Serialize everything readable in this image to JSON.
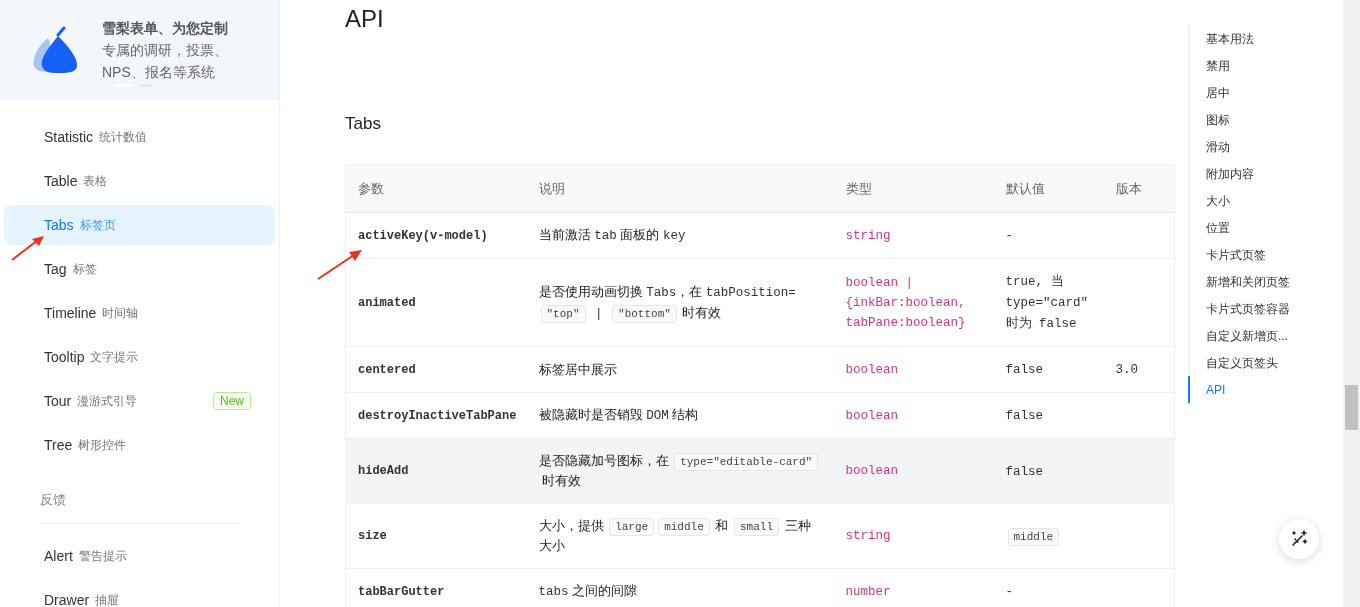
{
  "banner": {
    "title": "雪梨表单、为您定制",
    "text": "专属的调研，投票、NPS、报名等系统",
    "slides": [
      {
        "selected": true
      },
      {
        "selected": false
      }
    ]
  },
  "sidebar": {
    "items": [
      {
        "kind": "item",
        "name": "Statistic",
        "label": "统计数值",
        "selected": false
      },
      {
        "kind": "item",
        "name": "Table",
        "label": "表格",
        "selected": false
      },
      {
        "kind": "item",
        "name": "Tabs",
        "label": "标签页",
        "selected": true
      },
      {
        "kind": "item",
        "name": "Tag",
        "label": "标签",
        "selected": false
      },
      {
        "kind": "item",
        "name": "Timeline",
        "label": "时间轴",
        "selected": false
      },
      {
        "kind": "item",
        "name": "Tooltip",
        "label": "文字提示",
        "selected": false
      },
      {
        "kind": "item",
        "name": "Tour",
        "label": "漫游式引导",
        "selected": false,
        "badge": "New"
      },
      {
        "kind": "item",
        "name": "Tree",
        "label": "树形控件",
        "selected": false
      },
      {
        "kind": "group",
        "label": "反馈"
      },
      {
        "kind": "item",
        "name": "Alert",
        "label": "警告提示",
        "selected": false
      },
      {
        "kind": "item",
        "name": "Drawer",
        "label": "抽屉",
        "selected": false
      }
    ]
  },
  "main": {
    "title": "API",
    "section": "Tabs",
    "table": {
      "columns": [
        "参数",
        "说明",
        "类型",
        "默认值",
        "版本"
      ],
      "rows": [
        {
          "name": "activeKey(v-model)",
          "description": [
            {
              "kind": "text",
              "text": "当前激活 "
            },
            {
              "kind": "mono",
              "text": "tab"
            },
            {
              "kind": "text",
              "text": " 面板的 "
            },
            {
              "kind": "mono",
              "text": "key"
            }
          ],
          "type": "string",
          "default": [
            {
              "kind": "mono",
              "text": "-"
            }
          ],
          "highlighted": false
        },
        {
          "name": "animated",
          "description": [
            {
              "kind": "text",
              "text": "是否使用动画切换 "
            },
            {
              "kind": "mono",
              "text": "Tabs"
            },
            {
              "kind": "text",
              "text": "，在 "
            },
            {
              "kind": "mono",
              "text": "tabPosition="
            },
            {
              "kind": "code",
              "text": "″top″"
            },
            {
              "kind": "mono",
              "text": " | "
            },
            {
              "kind": "code",
              "text": "″bottom″"
            },
            {
              "kind": "text",
              "text": " 时有效"
            }
          ],
          "type": "boolean | {inkBar:boolean, tabPane:boolean}",
          "default": [
            {
              "kind": "mono",
              "text": "true, 当 "
            },
            {
              "kind": "mono",
              "text": "type=\"card\""
            },
            {
              "kind": "mono",
              "text": "时为 false"
            }
          ],
          "highlighted": false
        },
        {
          "name": "centered",
          "description": [
            {
              "kind": "text",
              "text": "标签居中展示"
            }
          ],
          "type": "boolean",
          "default": [
            {
              "kind": "mono",
              "text": "false"
            }
          ],
          "version": "3.0",
          "highlighted": false
        },
        {
          "name": "destroyInactiveTabPane",
          "description": [
            {
              "kind": "text",
              "text": "被隐藏时是否销毁 "
            },
            {
              "kind": "mono",
              "text": "DOM"
            },
            {
              "kind": "text",
              "text": " 结构"
            }
          ],
          "type": "boolean",
          "default": [
            {
              "kind": "mono",
              "text": "false"
            }
          ],
          "highlighted": false
        },
        {
          "name": "hideAdd",
          "description": [
            {
              "kind": "text",
              "text": "是否隐藏加号图标，在 "
            },
            {
              "kind": "code",
              "text": "type=″editable-card″"
            },
            {
              "kind": "text",
              "text": " 时有效"
            }
          ],
          "type": "boolean",
          "default": [
            {
              "kind": "mono",
              "text": "false"
            }
          ],
          "highlighted": true
        },
        {
          "name": "size",
          "description": [
            {
              "kind": "text",
              "text": "大小，提供 "
            },
            {
              "kind": "code",
              "text": "large"
            },
            {
              "kind": "code",
              "text": "middle"
            },
            {
              "kind": "text",
              "text": " 和 "
            },
            {
              "kind": "code",
              "text": "small"
            },
            {
              "kind": "text",
              "text": " 三种"
            },
            {
              "kind": "text",
              "text": "大小"
            }
          ],
          "type": "string",
          "default": [
            {
              "kind": "code",
              "text": "middle"
            }
          ],
          "highlighted": false
        },
        {
          "name": "tabBarGutter",
          "description": [
            {
              "kind": "mono",
              "text": "tabs"
            },
            {
              "kind": "text",
              "text": " 之间的间隙"
            }
          ],
          "type": "number",
          "default": [
            {
              "kind": "mono",
              "text": "-"
            }
          ],
          "highlighted": false
        }
      ]
    }
  },
  "toc": {
    "items": [
      {
        "label": "基本用法",
        "selected": false
      },
      {
        "label": "禁用",
        "selected": false
      },
      {
        "label": "居中",
        "selected": false
      },
      {
        "label": "图标",
        "selected": false
      },
      {
        "label": "滑动",
        "selected": false
      },
      {
        "label": "附加内容",
        "selected": false
      },
      {
        "label": "大小",
        "selected": false
      },
      {
        "label": "位置",
        "selected": false
      },
      {
        "label": "卡片式页签",
        "selected": false
      },
      {
        "label": "新增和关闭页签",
        "selected": false
      },
      {
        "label": "卡片式页签容器",
        "selected": false
      },
      {
        "label": "自定义新增页...",
        "selected": false
      },
      {
        "label": "自定义页签头",
        "selected": false
      },
      {
        "label": "API",
        "selected": true
      }
    ]
  }
}
